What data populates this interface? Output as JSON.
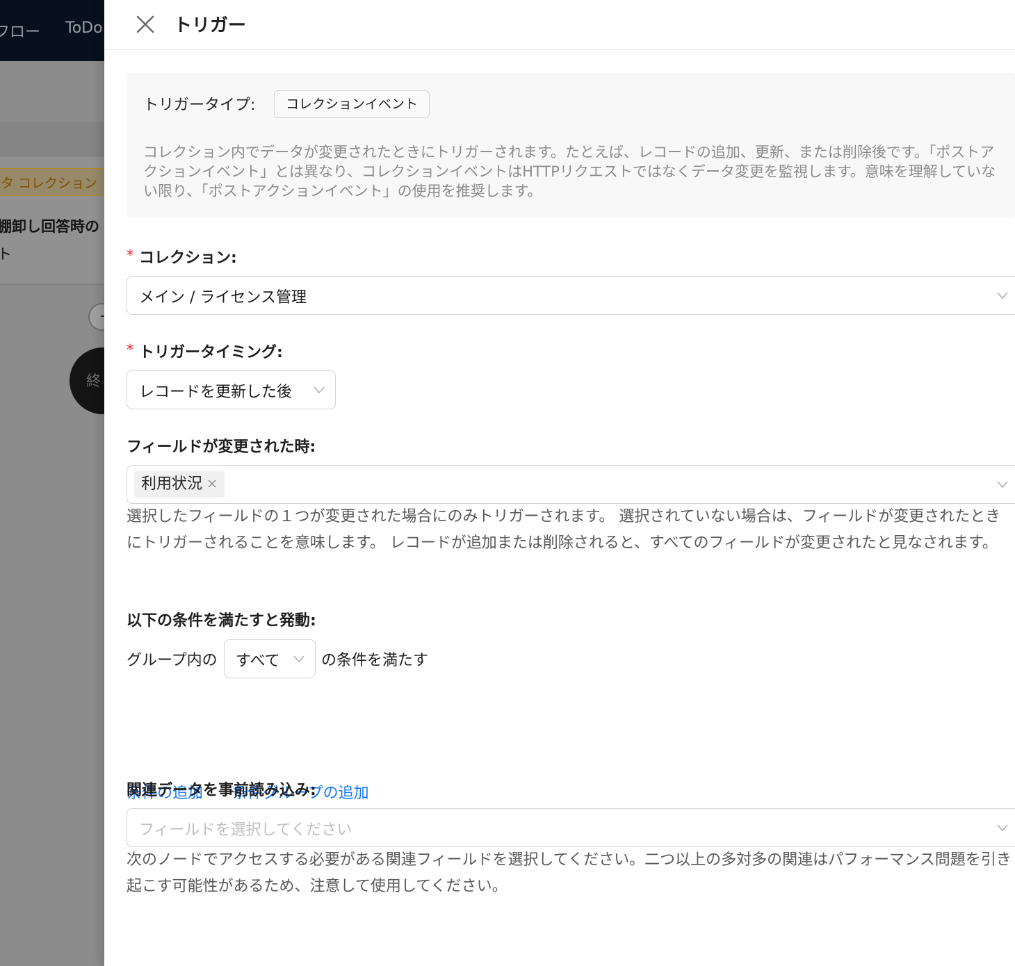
{
  "background": {
    "nav_items": [
      "フロー",
      "ToDo"
    ],
    "tag_label": "タ コレクション",
    "card_title": "棚卸し回答時の",
    "card_sub": "ト",
    "plus_symbol": "+",
    "end_node": "終"
  },
  "drawer": {
    "title": "トリガー",
    "close_icon": "close-icon",
    "trigger_type": {
      "label": "トリガータイプ:",
      "value": "コレクションイベント",
      "description": "コレクション内でデータが変更されたときにトリガーされます。たとえば、レコードの追加、更新、または削除後です。「ポストアクションイベント」とは異なり、コレクションイベントはHTTPリクエストではなくデータ変更を監視します。意味を理解していない限り、「ポストアクションイベント」の使用を推奨します。"
    },
    "collection": {
      "required_mark": "*",
      "label": "コレクション:",
      "value": "メイン / ライセンス管理"
    },
    "timing": {
      "required_mark": "*",
      "label": "トリガータイミング:",
      "value": "レコードを更新した後"
    },
    "changed_fields": {
      "label": "フィールドが変更された時:",
      "chips": [
        "利用状況"
      ],
      "help": "選択したフィールドの１つが変更された場合にのみトリガーされます。 選択されていない場合は、フィールドが変更されたときにトリガーされることを意味します。 レコードが追加または削除されると、すべてのフィールドが変更されたと見なされます。"
    },
    "conditions": {
      "label": "以下の条件を満たすと発動:",
      "prefix": "グループ内の",
      "mode": "すべて",
      "suffix": "の条件を満たす",
      "add_condition": "条件の追加",
      "add_group": "条件グループの追加"
    },
    "preload": {
      "label": "関連データを事前読み込み:",
      "placeholder": "フィールドを選択してください",
      "help": "次のノードでアクセスする必要がある関連フィールドを選択してください。二つ以上の多対多の関連はパフォーマンス問題を引き起こす可能性があるため、注意して使用してください。"
    }
  },
  "colors": {
    "link": "#1677ff",
    "required": "#f5222d",
    "overlay": "#8c8c8c"
  }
}
